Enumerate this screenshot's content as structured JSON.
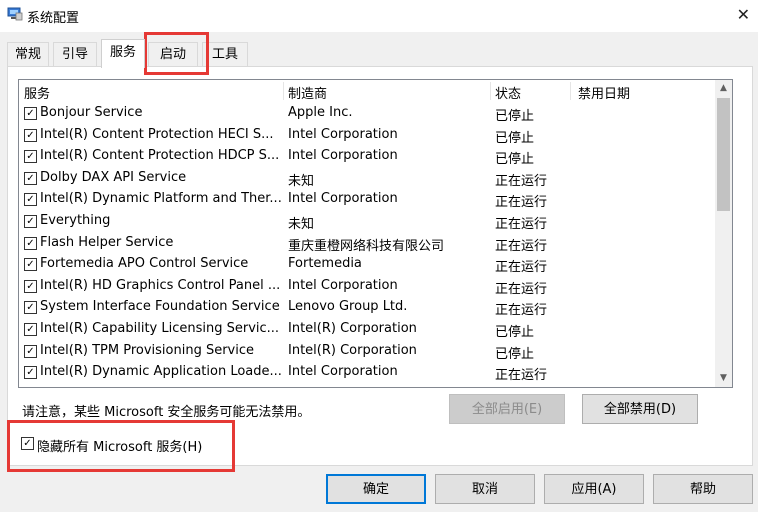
{
  "window": {
    "title": "系统配置",
    "close_glyph": "✕"
  },
  "tabs": [
    "常规",
    "引导",
    "服务",
    "启动",
    "工具"
  ],
  "services": {
    "columns": [
      "服务",
      "制造商",
      "状态",
      "禁用日期"
    ],
    "rows": [
      {
        "name": "Bonjour Service",
        "manufacturer": "Apple Inc.",
        "status": "已停止",
        "checked": true
      },
      {
        "name": "Intel(R) Content Protection HECI S...",
        "manufacturer": "Intel Corporation",
        "status": "已停止",
        "checked": true
      },
      {
        "name": "Intel(R) Content Protection HDCP S...",
        "manufacturer": "Intel Corporation",
        "status": "已停止",
        "checked": true
      },
      {
        "name": "Dolby DAX API Service",
        "manufacturer": "未知",
        "status": "正在运行",
        "checked": true
      },
      {
        "name": "Intel(R) Dynamic Platform and Ther...",
        "manufacturer": "Intel Corporation",
        "status": "正在运行",
        "checked": true
      },
      {
        "name": "Everything",
        "manufacturer": "未知",
        "status": "正在运行",
        "checked": true
      },
      {
        "name": "Flash Helper Service",
        "manufacturer": "重庆重橙网络科技有限公司",
        "status": "正在运行",
        "checked": true
      },
      {
        "name": "Fortemedia APO Control Service",
        "manufacturer": "Fortemedia",
        "status": "正在运行",
        "checked": true
      },
      {
        "name": "Intel(R) HD Graphics Control Panel ...",
        "manufacturer": "Intel Corporation",
        "status": "正在运行",
        "checked": true
      },
      {
        "name": "System Interface Foundation Service",
        "manufacturer": "Lenovo Group Ltd.",
        "status": "正在运行",
        "checked": true
      },
      {
        "name": "Intel(R) Capability Licensing Servic...",
        "manufacturer": "Intel(R) Corporation",
        "status": "已停止",
        "checked": true
      },
      {
        "name": "Intel(R) TPM Provisioning Service",
        "manufacturer": "Intel(R) Corporation",
        "status": "已停止",
        "checked": true
      },
      {
        "name": "Intel(R) Dynamic Application Loade...",
        "manufacturer": "Intel Corporation",
        "status": "正在运行",
        "checked": true
      }
    ]
  },
  "notice": "请注意，某些 Microsoft 安全服务可能无法禁用。",
  "buttons": {
    "enable_all": "全部启用(E)",
    "disable_all": "全部禁用(D)",
    "ok": "确定",
    "cancel": "取消",
    "apply": "应用(A)",
    "help": "帮助"
  },
  "hide_ms": {
    "label": "隐藏所有 Microsoft 服务(H)",
    "checked": true
  },
  "check_glyph": "✓",
  "highlight_color": "#e53935"
}
